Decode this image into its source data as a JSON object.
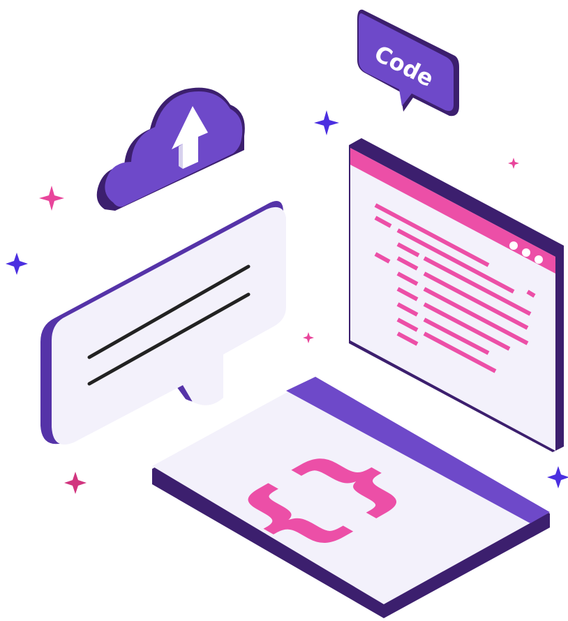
{
  "speech_bubble": {
    "label": "Code"
  },
  "keyboard_card": {
    "symbol": "{}"
  },
  "colors": {
    "purple": "#6e49c9",
    "purple_dark": "#3c1f6e",
    "purple_mid": "#5533a8",
    "pink": "#ec4fa7",
    "panel": "#f3f1fb",
    "sparkle_blue": "#4b2fe0",
    "sparkle_pink": "#e8459b",
    "line_dark": "#222222"
  },
  "icons": [
    "cloud-upload-icon",
    "up-arrow-icon",
    "sparkle-icon"
  ]
}
